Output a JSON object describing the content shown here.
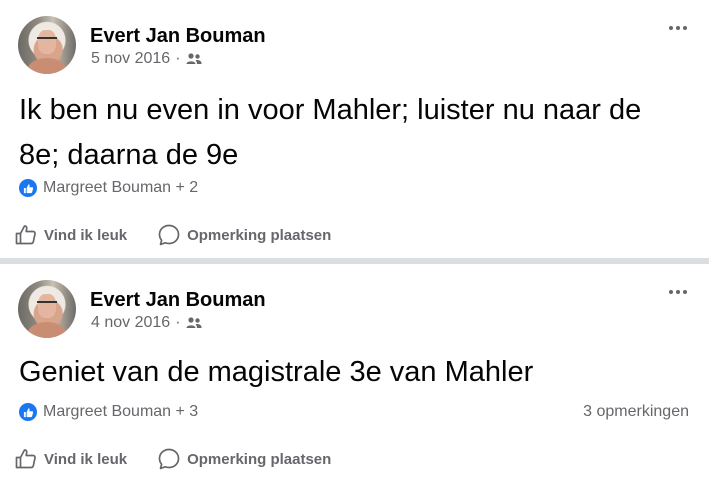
{
  "colors": {
    "accent": "#1877f2",
    "muted": "#65676b",
    "divider": "#dadde1"
  },
  "posts": [
    {
      "author": "Evert Jan Bouman",
      "date": "5 nov 2016",
      "separator": "·",
      "audience_icon": "friends-icon",
      "text": "Ik ben nu even in voor Mahler; luister nu naar de 8e; daarna de 9e",
      "reactions": "Margreet Bouman + 2",
      "comments": "",
      "like_label": "Vind ik leuk",
      "comment_label": "Opmerking plaatsen"
    },
    {
      "author": "Evert Jan Bouman",
      "date": "4 nov 2016",
      "separator": "·",
      "audience_icon": "friends-icon",
      "text": "Geniet van de magistrale 3e van Mahler",
      "reactions": "Margreet Bouman + 3",
      "comments": "3 opmerkingen",
      "like_label": "Vind ik leuk",
      "comment_label": "Opmerking plaatsen"
    }
  ]
}
